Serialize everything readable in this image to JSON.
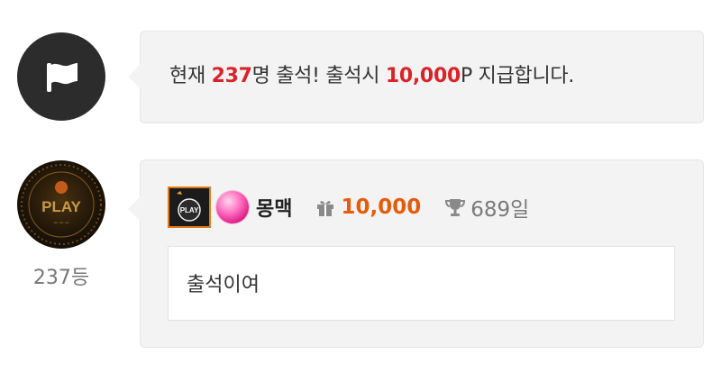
{
  "notice": {
    "prefix": "현재 ",
    "count": "237",
    "middle": "명 출석! 출석시 ",
    "reward": "10,000",
    "suffix": "P 지급합니다."
  },
  "entry": {
    "rank_label": "237등",
    "nickname": "몽맥",
    "points": "10,000",
    "days": "689일",
    "comment": "출석이여",
    "badge_text": "PLAY",
    "avatar_text": "PLAY"
  },
  "colors": {
    "highlight": "#d8232a",
    "points": "#e45d0d",
    "level_orb": "#ff74c2"
  },
  "icons": {
    "notice": "flag-icon",
    "gift": "gift-icon",
    "trophy": "trophy-icon"
  }
}
